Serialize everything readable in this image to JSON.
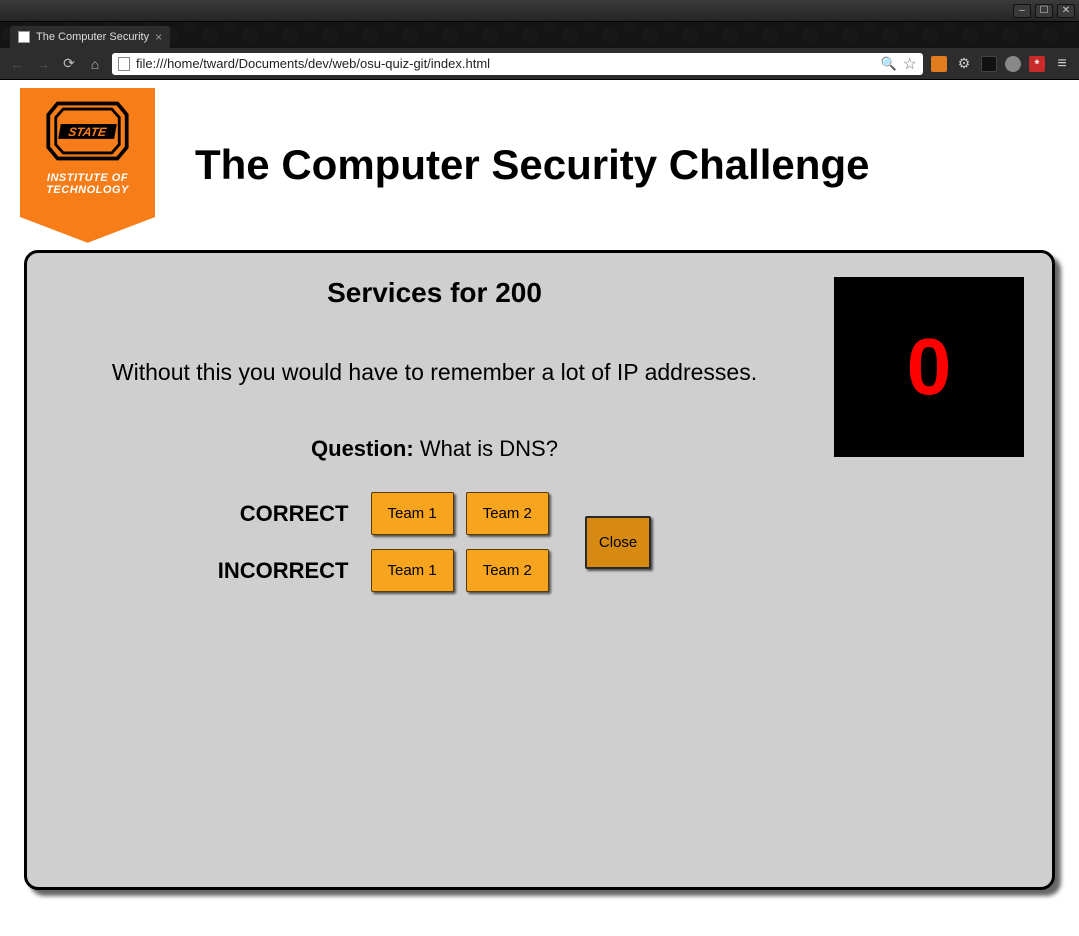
{
  "window": {
    "tab_title": "The Computer Security",
    "url": "file:///home/tward/Documents/dev/web/osu-quiz-git/index.html"
  },
  "banner": {
    "line1": "INSTITUTE OF",
    "line2": "TECHNOLOGY",
    "logo_word": "STATE"
  },
  "page": {
    "title": "The Computer Security Challenge"
  },
  "card": {
    "category_heading": "Services for 200",
    "clue": "Without this you would have to remember a lot of IP addresses.",
    "question_label": "Question:",
    "answer": "What is DNS?",
    "timer_value": "0",
    "correct_label": "CORRECT",
    "incorrect_label": "INCORRECT",
    "team1_label": "Team 1",
    "team2_label": "Team 2",
    "close_label": "Close"
  },
  "colors": {
    "brand_orange": "#f77d19",
    "button_orange": "#f7a51e",
    "timer_red": "#ff0000"
  }
}
